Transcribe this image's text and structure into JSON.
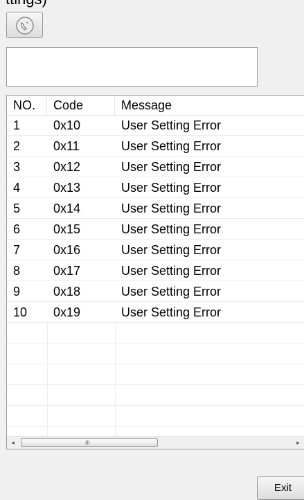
{
  "top_text": "ttings)",
  "message_box": {
    "text": ""
  },
  "table": {
    "headers": {
      "no": "NO.",
      "code": "Code",
      "message": "Message"
    },
    "rows": [
      {
        "no": "1",
        "code": "0x10",
        "message": "User Setting Error"
      },
      {
        "no": "2",
        "code": "0x11",
        "message": "User Setting Error"
      },
      {
        "no": "3",
        "code": "0x12",
        "message": "User Setting Error"
      },
      {
        "no": "4",
        "code": "0x13",
        "message": "User Setting Error"
      },
      {
        "no": "5",
        "code": "0x14",
        "message": "User Setting Error"
      },
      {
        "no": "6",
        "code": "0x15",
        "message": "User Setting Error"
      },
      {
        "no": "7",
        "code": "0x16",
        "message": "User Setting Error"
      },
      {
        "no": "8",
        "code": "0x17",
        "message": "User Setting Error"
      },
      {
        "no": "9",
        "code": "0x18",
        "message": "User Setting Error"
      },
      {
        "no": "10",
        "code": "0x19",
        "message": "User Setting Error"
      }
    ]
  },
  "scrollbar": {
    "left_arrow": "◂",
    "right_arrow": "▸",
    "grip": "III"
  },
  "buttons": {
    "phone_icon": "phone-icon",
    "exit_label": "Exit"
  }
}
